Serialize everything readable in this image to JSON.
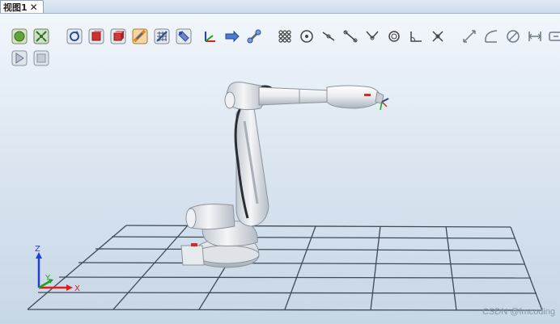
{
  "tabs": [
    {
      "label": "视图1",
      "close_glyph": "✕"
    }
  ],
  "toolbar": {
    "icons_row1": [
      "view-all-icon",
      "fit-icon",
      "rotate-view-icon",
      "box-select-icon",
      "cube-view-icon",
      "path-tool-icon",
      "grid-tool-icon",
      "move-tool-icon",
      "frame-axis-icon",
      "jog-right-icon",
      "link-tool-icon",
      "snap-grid-icon",
      "snap-center-icon",
      "snap-edge-icon",
      "snap-line-icon",
      "snap-angle-icon",
      "snap-circle-icon",
      "measure-angle-icon",
      "snap-cross-icon",
      "measure-distance-icon",
      "measure-arc-icon",
      "measure-diameter-icon",
      "measure-min-icon",
      "measure-extra-icon"
    ],
    "icons_row2": [
      "play-icon",
      "stop-icon"
    ]
  },
  "axes": {
    "x": "X",
    "y": "Y",
    "z": "Z"
  },
  "colors": {
    "axis_x": "#e31d1d",
    "axis_y": "#1ba41b",
    "axis_z": "#1f3fd6",
    "grid": "#3f4a56",
    "robot_body": "#eef0f3",
    "robot_shade": "#b8bec6",
    "abb_red": "#d42a2a"
  },
  "watermark": "CSDN @fmcoding"
}
